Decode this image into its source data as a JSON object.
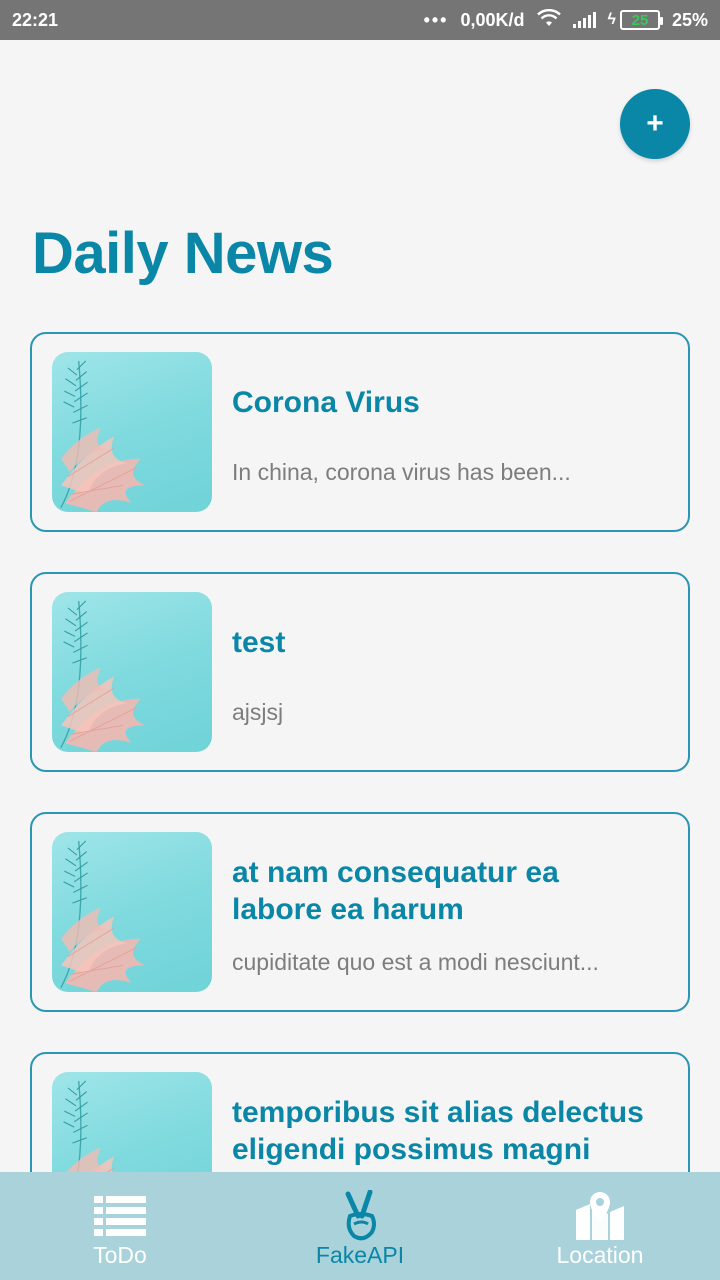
{
  "status_bar": {
    "time": "22:21",
    "more": "•••",
    "network_speed": "0,00K/d",
    "battery_level": "25",
    "battery_percent": "25%"
  },
  "fab": {
    "label": "+",
    "icon": "plus-icon"
  },
  "page": {
    "title": "Daily News"
  },
  "news": [
    {
      "title": "Corona Virus",
      "description": "In china, corona virus has been..."
    },
    {
      "title": "test",
      "description": "ajsjsj"
    },
    {
      "title": "at nam consequatur ea labore ea harum",
      "description": "cupiditate quo est a modi nesciunt..."
    },
    {
      "title": "temporibus sit alias delectus eligendi possimus magni",
      "description": ""
    }
  ],
  "bottom_nav": {
    "items": [
      {
        "label": "ToDo",
        "icon": "list-icon"
      },
      {
        "label": "FakeAPI",
        "icon": "peace-hand-icon"
      },
      {
        "label": "Location",
        "icon": "map-pin-icon"
      }
    ],
    "active": "FakeAPI"
  },
  "colors": {
    "accent": "#0a86a6",
    "card_border": "#2a96b4",
    "nav_background": "#a9d2db",
    "status_bar": "#757575",
    "background": "#f5f5f6"
  }
}
